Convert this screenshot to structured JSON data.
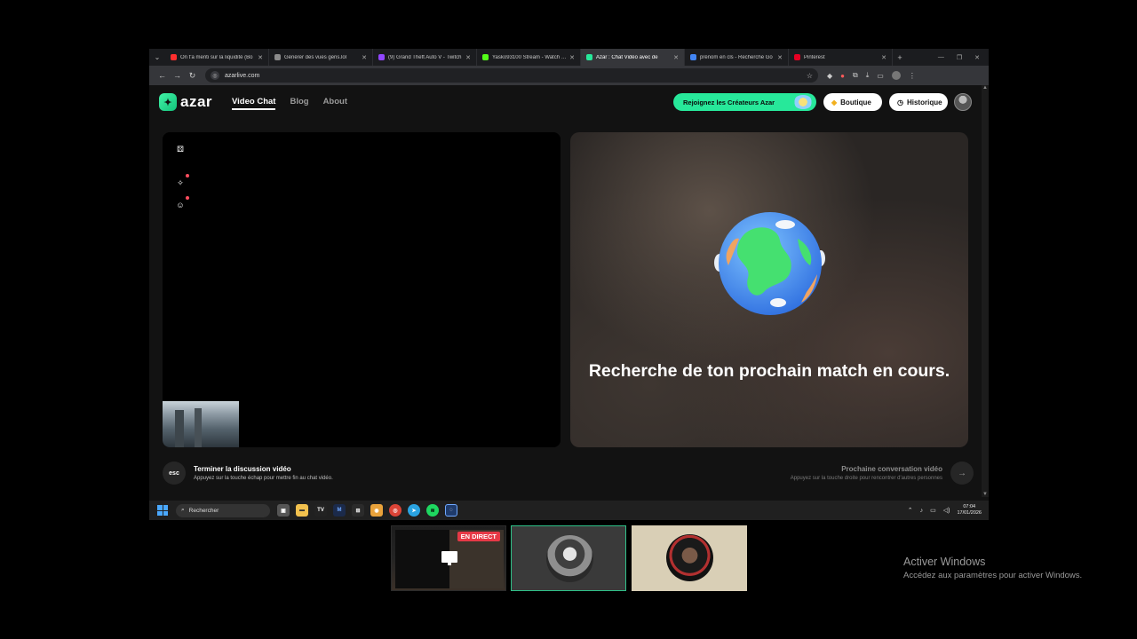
{
  "browser": {
    "tabs": [
      {
        "title": "On t'a menti sur la liquidité (Bo",
        "color": "#ff2e2e",
        "active": false
      },
      {
        "title": "Générer des vues gens.lol",
        "color": "#8a8a8a",
        "active": false
      },
      {
        "title": "(9) Grand Theft Auto V - Twitch",
        "color": "#9146ff",
        "active": false
      },
      {
        "title": "Yasko93100 Stream - Watch Liv",
        "color": "#53fc18",
        "active": false
      },
      {
        "title": "Azar : Chat Vidéo avec de",
        "color": "#27e89a",
        "active": true
      },
      {
        "title": "prénom en cls - Recherche Go",
        "color": "#4285f4",
        "active": false
      },
      {
        "title": "Pinterest",
        "color": "#e60023",
        "active": false
      }
    ],
    "url": "azarlive.com"
  },
  "site": {
    "logo": "azar",
    "nav": [
      "Video Chat",
      "Blog",
      "About"
    ],
    "creators_button": "Rejoignez les Créateurs Azar",
    "shop_button": "Boutique",
    "history_button": "Historique",
    "search_message": "Recherche de ton prochain match en cours.",
    "end_title": "Terminer la discussion vidéo",
    "end_sub": "Appuyez sur la touche échap pour mettre fin au chat vidéo.",
    "esc_key": "esc",
    "next_title": "Prochaine conversation vidéo",
    "next_sub": "Appuyez sur la touche droite pour rencontrer d'autres personnes"
  },
  "taskbar": {
    "search_placeholder": "Rechercher",
    "time": "07:04",
    "date": "17/01/2026"
  },
  "stream": {
    "live_badge": "EN DIRECT"
  },
  "watermark": {
    "title": "Activer Windows",
    "sub": "Accédez aux paramètres pour activer Windows."
  },
  "colors": {
    "accent": "#27e89a",
    "live": "#e63946"
  }
}
